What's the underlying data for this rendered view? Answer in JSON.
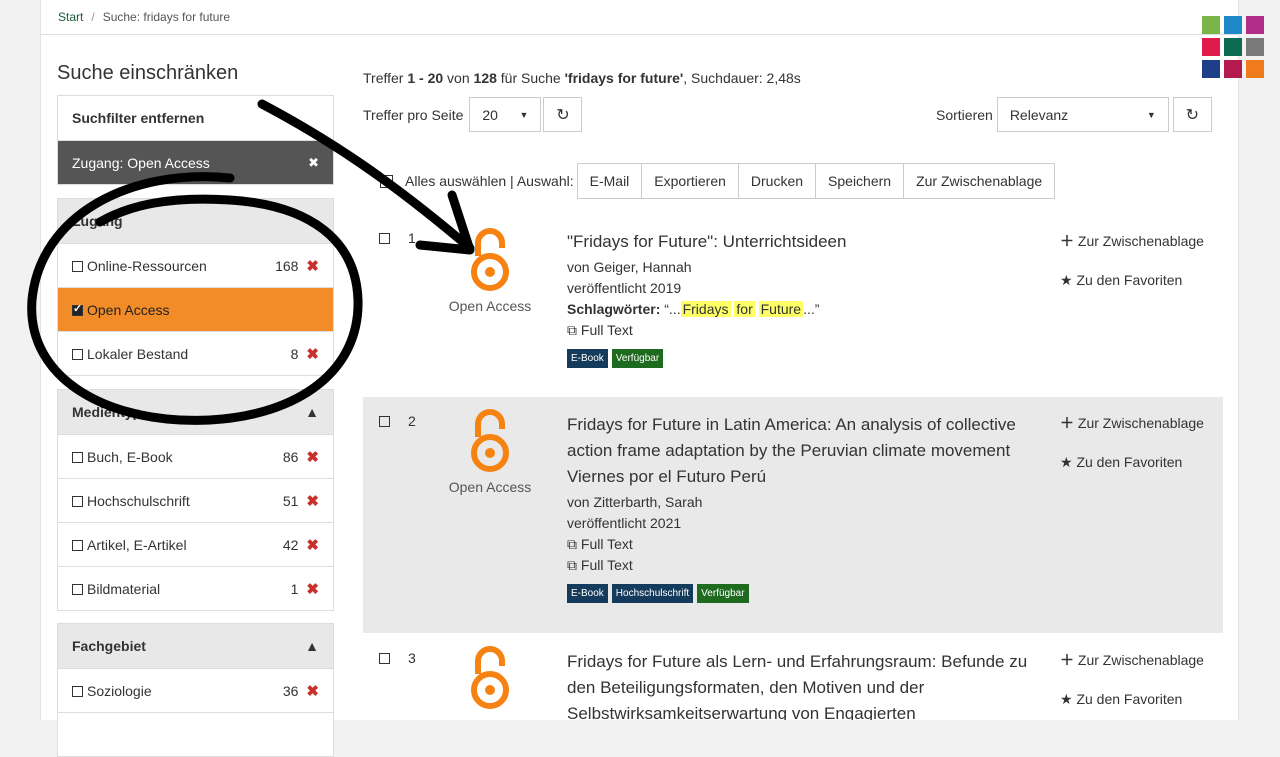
{
  "breadcrumb": {
    "home": "Start",
    "separator": "/",
    "current": "Suche: fridays for future"
  },
  "logo": {
    "colors": [
      "#7ab547",
      "#1e88c8",
      "#b22c8a",
      "#e01b4c",
      "#0e6a51",
      "#7a7a7a",
      "#1d3f8a",
      "#b51a4f",
      "#f07b1d"
    ]
  },
  "sidebar": {
    "title": "Suche einschränken",
    "remove_filters": "Suchfilter entfernen",
    "active_filter": "Zugang: Open Access",
    "active_filter_close": "✖",
    "zugang": {
      "head": "Zugang",
      "items": [
        {
          "label": "Online-Ressourcen",
          "count": "168",
          "remove": "✖"
        },
        {
          "label": "Open Access"
        },
        {
          "label": "Lokaler Bestand",
          "count": "8",
          "remove": "✖"
        }
      ]
    },
    "medientyp": {
      "head": "Medientyp",
      "toggle": "▲",
      "items": [
        {
          "label": "Buch, E-Book",
          "count": "86",
          "remove": "✖"
        },
        {
          "label": "Hochschulschrift",
          "count": "51",
          "remove": "✖"
        },
        {
          "label": "Artikel, E-Artikel",
          "count": "42",
          "remove": "✖"
        },
        {
          "label": "Bildmaterial",
          "count": "1",
          "remove": "✖"
        }
      ]
    },
    "fachgebiet": {
      "head": "Fachgebiet",
      "toggle": "▲",
      "items": [
        {
          "label": "Soziologie",
          "count": "36",
          "remove": "✖"
        }
      ]
    }
  },
  "main": {
    "hits": {
      "prefix": "Treffer ",
      "range": "1 - 20",
      "of": " von ",
      "total": "128",
      "for": " für Suche ",
      "query": "'fridays for future'",
      "duration": ", Suchdauer: 2,48s"
    },
    "per_page_label": "Treffer pro Seite",
    "per_page_value": "20",
    "refresh": "↻",
    "sort_label": "Sortieren",
    "sort_value": "Relevanz",
    "select_all": "Alles auswählen | Auswahl:",
    "actions": [
      "E-Mail",
      "Exportieren",
      "Drucken",
      "Speichern",
      "Zur Zwischenablage"
    ],
    "results": [
      {
        "num": "1",
        "oa_label": "Open Access",
        "title": "\"Fridays for Future\": Unterrichtsideen",
        "by_prefix": "von ",
        "author": "Geiger, Hannah",
        "published": "veröffentlicht 2019",
        "keywords_label": "Schlagwörter:",
        "keywords_open": " “...",
        "keywords_terms": [
          "Fridays",
          "for",
          "Future"
        ],
        "keywords_close": "...”",
        "fulltext": [
          "Full Text"
        ],
        "badges": [
          {
            "label": "E-Book",
            "color": "blue"
          },
          {
            "label": "Verfügbar",
            "color": "green"
          }
        ],
        "add_clip": "Zur Zwischenablage",
        "add_fav": "Zu den Favoriten"
      },
      {
        "num": "2",
        "oa_label": "Open Access",
        "title": "Fridays for Future in Latin America: An analysis of collective action frame adaptation by the Peruvian climate movement Viernes por el Futuro Perú",
        "by_prefix": "von ",
        "author": "Zitterbarth, Sarah",
        "published": "veröffentlicht 2021",
        "fulltext": [
          "Full Text",
          "Full Text"
        ],
        "badges": [
          {
            "label": "E-Book",
            "color": "blue"
          },
          {
            "label": "Hochschulschrift",
            "color": "blue"
          },
          {
            "label": "Verfügbar",
            "color": "green"
          }
        ],
        "add_clip": "Zur Zwischenablage",
        "add_fav": "Zu den Favoriten"
      },
      {
        "num": "3",
        "title": "Fridays for Future als Lern- und Erfahrungsraum: Befunde zu den Beteiligungsformaten, den Motiven und der Selbstwirksamkeitserwartung von Engagierten",
        "add_clip": "Zur Zwischenablage",
        "add_fav": "Zu den Favoriten"
      }
    ]
  }
}
